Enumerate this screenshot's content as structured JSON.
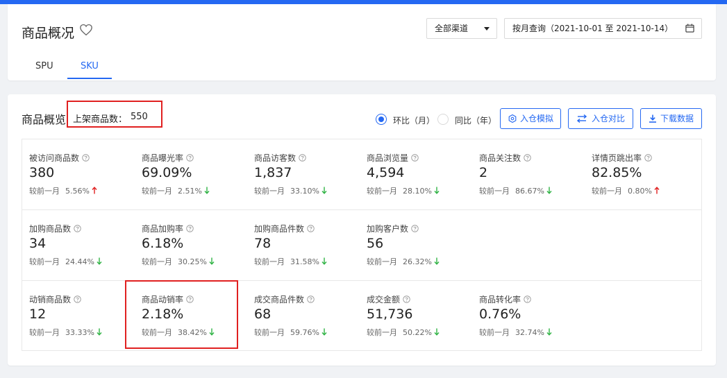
{
  "colors": {
    "accent": "#2468f2",
    "up": "#e02020",
    "down": "#2fb344",
    "highlight_border": "#e02020"
  },
  "header": {
    "title": "商品概况",
    "favorite_icon": "heart-outline-icon",
    "channel_select": {
      "value": "全部渠道"
    },
    "date_range": {
      "value": "按月查询（2021-10-01 至 2021-10-14）",
      "icon": "calendar-icon"
    },
    "tabs": [
      {
        "label": "SPU",
        "active": false
      },
      {
        "label": "SKU",
        "active": true
      }
    ]
  },
  "overview": {
    "title": "商品概览",
    "listed": {
      "label": "上架商品数：",
      "value": "550"
    },
    "compare_modes": [
      {
        "label": "环比（月）",
        "selected": true
      },
      {
        "label": "同比（年）",
        "selected": false
      }
    ],
    "buttons": {
      "simulate": "入仓模拟",
      "compare": "入仓对比",
      "download": "下载数据"
    },
    "compare_prefix": "较前一月",
    "rows": [
      [
        {
          "label": "被访问商品数",
          "value": "380",
          "pct": "5.56%",
          "trend": "up"
        },
        {
          "label": "商品曝光率",
          "value": "69.09%",
          "pct": "2.51%",
          "trend": "down"
        },
        {
          "label": "商品访客数",
          "value": "1,837",
          "pct": "33.10%",
          "trend": "down"
        },
        {
          "label": "商品浏览量",
          "value": "4,594",
          "pct": "28.10%",
          "trend": "down"
        },
        {
          "label": "商品关注数",
          "value": "2",
          "pct": "86.67%",
          "trend": "down"
        },
        {
          "label": "详情页跳出率",
          "value": "82.85%",
          "pct": "0.80%",
          "trend": "up"
        }
      ],
      [
        {
          "label": "加购商品数",
          "value": "34",
          "pct": "24.44%",
          "trend": "down"
        },
        {
          "label": "商品加购率",
          "value": "6.18%",
          "pct": "30.25%",
          "trend": "down"
        },
        {
          "label": "加购商品件数",
          "value": "78",
          "pct": "31.58%",
          "trend": "down"
        },
        {
          "label": "加购客户数",
          "value": "56",
          "pct": "26.32%",
          "trend": "down"
        }
      ],
      [
        {
          "label": "动销商品数",
          "value": "12",
          "pct": "33.33%",
          "trend": "down"
        },
        {
          "label": "商品动销率",
          "value": "2.18%",
          "pct": "38.42%",
          "trend": "down"
        },
        {
          "label": "成交商品件数",
          "value": "68",
          "pct": "59.76%",
          "trend": "down"
        },
        {
          "label": "成交金额",
          "value": "51,736",
          "pct": "50.22%",
          "trend": "down"
        },
        {
          "label": "商品转化率",
          "value": "0.76%",
          "pct": "32.74%",
          "trend": "down"
        }
      ]
    ]
  }
}
